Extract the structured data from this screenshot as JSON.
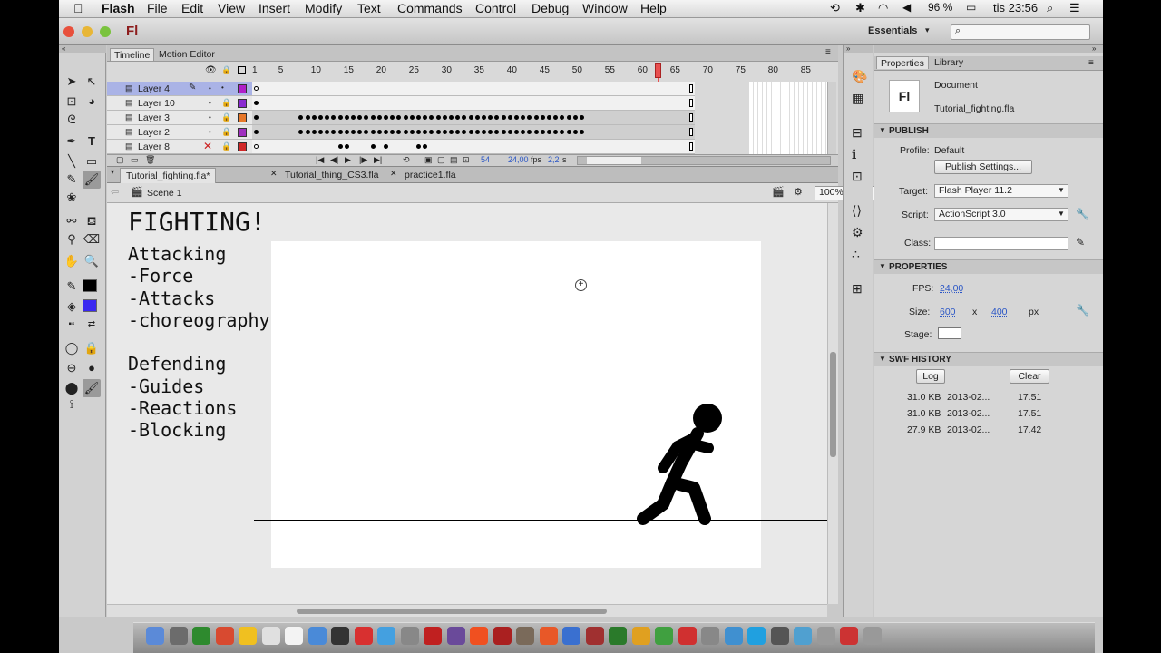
{
  "menubar": {
    "apple": "",
    "app": "Flash",
    "items": [
      "File",
      "Edit",
      "View",
      "Insert",
      "Modify",
      "Text",
      "Commands",
      "Control",
      "Debug",
      "Window",
      "Help"
    ],
    "battery": "96 %",
    "clock": "tis 23:56"
  },
  "titlebar": {
    "logo": "Fl",
    "workspace": "Essentials",
    "search_placeholder": ""
  },
  "timeline": {
    "tab_timeline": "Timeline",
    "tab_motion": "Motion Editor",
    "frame_numbers": [
      "1",
      "5",
      "10",
      "15",
      "20",
      "25",
      "30",
      "35",
      "40",
      "45",
      "50",
      "55",
      "60",
      "65",
      "70",
      "75",
      "80",
      "85"
    ],
    "layers": [
      {
        "name": "Layer 4",
        "color": "#b020c8",
        "selected": true
      },
      {
        "name": "Layer 10",
        "color": "#8a2ad0"
      },
      {
        "name": "Layer 3",
        "color": "#e8782a"
      },
      {
        "name": "Layer 2",
        "color": "#a030c0"
      },
      {
        "name": "Layer 8",
        "color": "#d02828"
      }
    ],
    "current_frame": "54",
    "fps": "24,00",
    "fps_unit": "fps",
    "time": "2,2",
    "time_unit": "s"
  },
  "doctabs": [
    "Tutorial_fighting.fla*",
    "Tutorial_thing_CS3.fla",
    "practice1.fla"
  ],
  "editbar": {
    "scene": "Scene 1",
    "zoom": "100%"
  },
  "stage_text": {
    "title": "FIGHTING!",
    "attack": [
      "Attacking",
      "-Force",
      "-Attacks",
      "-choreography"
    ],
    "defend": [
      "Defending",
      "-Guides",
      "-Reactions",
      "-Blocking"
    ]
  },
  "props": {
    "tab_props": "Properties",
    "tab_lib": "Library",
    "doc_icon": "Fl",
    "doc_label": "Document",
    "doc_file": "Tutorial_fighting.fla",
    "publish": "PUBLISH",
    "profile_label": "Profile:",
    "profile_value": "Default",
    "publish_settings": "Publish Settings...",
    "target_label": "Target:",
    "target_value": "Flash Player 11.2",
    "script_label": "Script:",
    "script_value": "ActionScript 3.0",
    "class_label": "Class:",
    "properties": "PROPERTIES",
    "fps_label": "FPS:",
    "fps_value": "24,00",
    "size_label": "Size:",
    "width": "600",
    "x": "x",
    "height": "400",
    "unit": "px",
    "stage_label": "Stage:",
    "swf": "SWF HISTORY",
    "log": "Log",
    "clear": "Clear",
    "history": [
      {
        "size": "31.0 KB",
        "date": "2013-02...",
        "time": "17.51"
      },
      {
        "size": "31.0 KB",
        "date": "2013-02...",
        "time": "17.51"
      },
      {
        "size": "27.9 KB",
        "date": "2013-02...",
        "time": "17.42"
      }
    ]
  },
  "colors": {
    "stroke": "#000000",
    "fill": "#3a28f0",
    "selected_layer": "#aab3e6",
    "playhead": "#e85050"
  }
}
